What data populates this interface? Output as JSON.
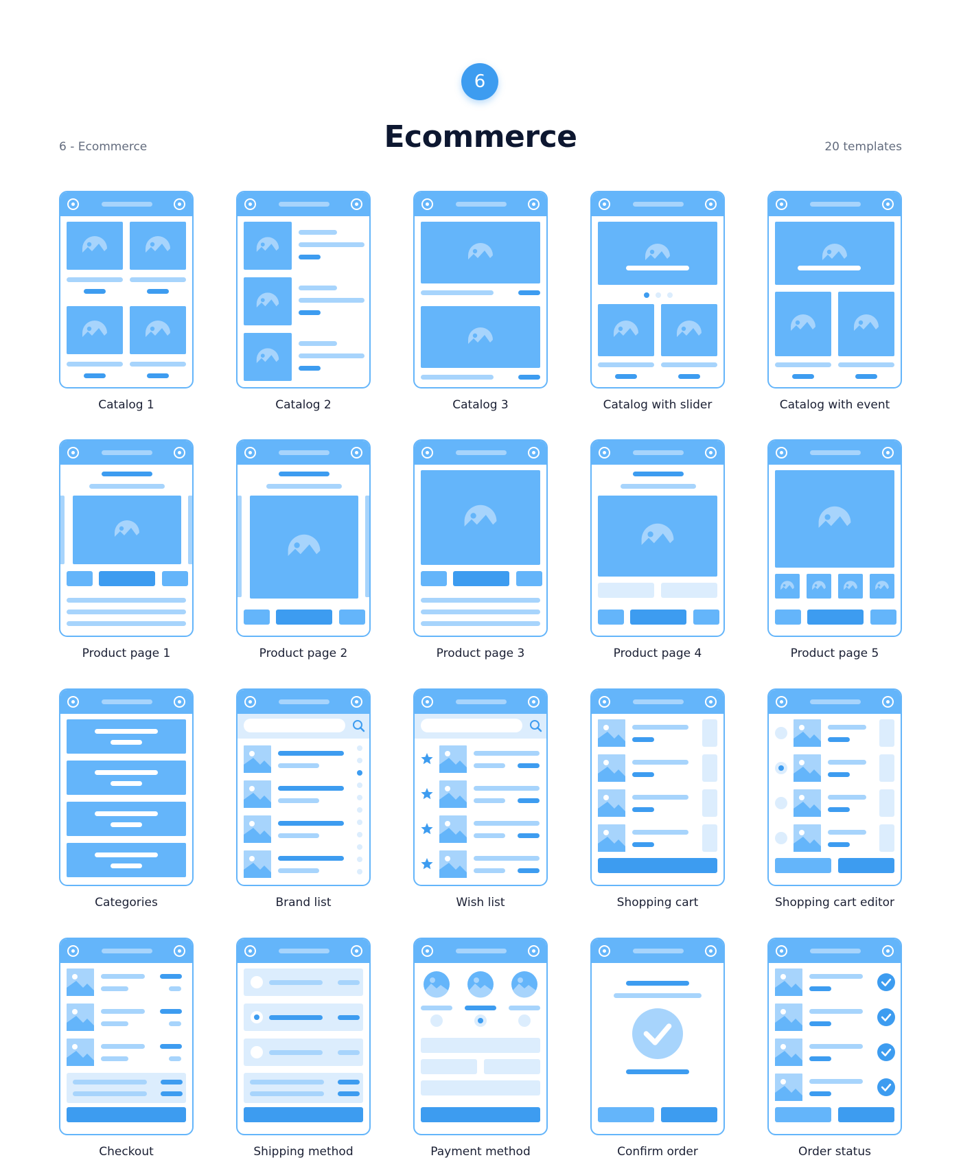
{
  "header": {
    "section_number": "6",
    "title": "Ecommerce",
    "left_caption": "6 - Ecommerce",
    "right_caption": "20 templates"
  },
  "colors": {
    "accent": "#3d9cf0",
    "primary": "#64b5fa",
    "light": "#a7d4fc",
    "pale": "#dcedfd"
  },
  "templates": [
    {
      "label": "Catalog 1",
      "icon": "catalog-grid-wireframe"
    },
    {
      "label": "Catalog 2",
      "icon": "catalog-list-wireframe"
    },
    {
      "label": "Catalog 3",
      "icon": "catalog-large-wireframe"
    },
    {
      "label": "Catalog with slider",
      "icon": "catalog-slider-wireframe"
    },
    {
      "label": "Catalog with event",
      "icon": "catalog-event-wireframe"
    },
    {
      "label": "Product page 1",
      "icon": "product-page-wireframe"
    },
    {
      "label": "Product page 2",
      "icon": "product-page-wireframe"
    },
    {
      "label": "Product page 3",
      "icon": "product-page-wireframe"
    },
    {
      "label": "Product page 4",
      "icon": "product-page-wireframe"
    },
    {
      "label": "Product page 5",
      "icon": "product-page-wireframe"
    },
    {
      "label": "Categories",
      "icon": "categories-wireframe"
    },
    {
      "label": "Brand list",
      "icon": "brand-list-wireframe"
    },
    {
      "label": "Wish list",
      "icon": "wish-list-wireframe"
    },
    {
      "label": "Shopping cart",
      "icon": "cart-wireframe"
    },
    {
      "label": "Shopping cart editor",
      "icon": "cart-editor-wireframe"
    },
    {
      "label": "Checkout",
      "icon": "checkout-wireframe"
    },
    {
      "label": "Shipping method",
      "icon": "shipping-wireframe"
    },
    {
      "label": "Payment method",
      "icon": "payment-wireframe"
    },
    {
      "label": "Confirm order",
      "icon": "confirm-wireframe"
    },
    {
      "label": "Order status",
      "icon": "order-status-wireframe"
    }
  ]
}
